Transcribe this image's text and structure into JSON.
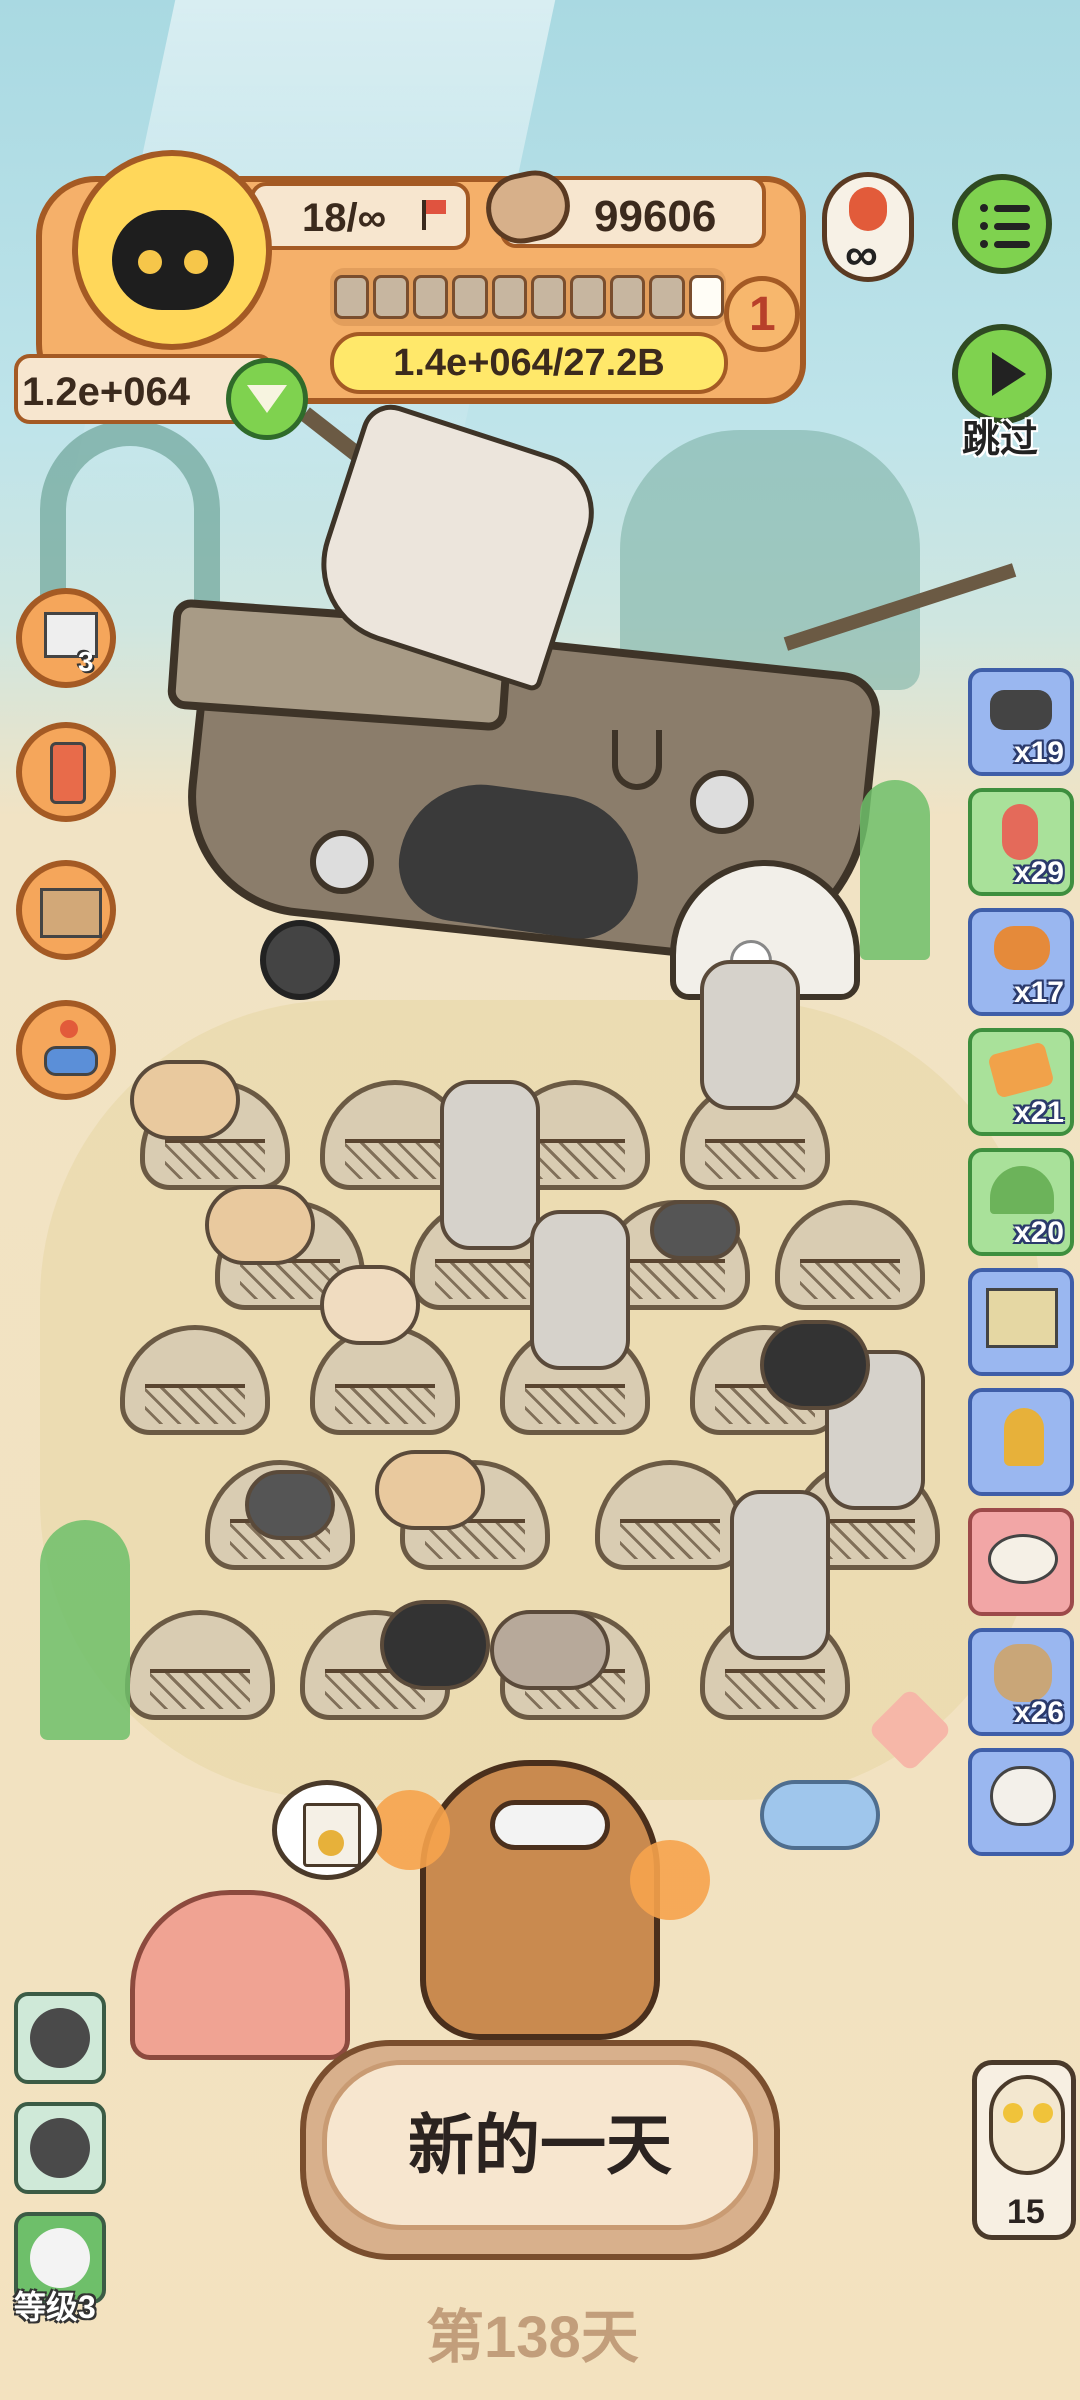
{
  "hud": {
    "capacity": "18/∞",
    "coins": "99606",
    "progress_label": "1.4e+064/27.2B",
    "level_number": "1",
    "resource_value": "1.2e+064",
    "progress_segments_filled": 9,
    "progress_segments_total": 10
  },
  "buttons": {
    "skip_label": "跳过",
    "menu_icon": "list-icon",
    "new_day_label": "新的一天",
    "infinity_symbol": "∞"
  },
  "left_tools": [
    {
      "name": "hourglass-book-icon",
      "badge": "3"
    },
    {
      "name": "phone-icon",
      "badge": ""
    },
    {
      "name": "box-icon",
      "badge": ""
    },
    {
      "name": "joystick-icon",
      "badge": ""
    }
  ],
  "right_inventory": [
    {
      "icon": "gadget-icon",
      "count": "x19",
      "style": "blue"
    },
    {
      "icon": "flamingo-icon",
      "count": "x29",
      "style": "green"
    },
    {
      "icon": "bread-icon",
      "count": "x17",
      "style": "blue"
    },
    {
      "icon": "ticket-icon",
      "count": "x21",
      "style": "green"
    },
    {
      "icon": "tent-icon",
      "count": "x20",
      "style": "green"
    },
    {
      "icon": "hut-icon",
      "count": "",
      "style": "blue"
    },
    {
      "icon": "trophy-icon",
      "count": "",
      "style": "blue"
    },
    {
      "icon": "fish-plate-icon",
      "count": "",
      "style": "red"
    },
    {
      "icon": "sack-icon",
      "count": "x26",
      "style": "blue"
    },
    {
      "icon": "sheep-icon",
      "count": "",
      "style": "blue"
    }
  ],
  "bottom": {
    "day_label": "第138天",
    "level_label": "等级3",
    "owl_count": "15"
  },
  "colors": {
    "hud_orange": "#f5b06a",
    "hud_border": "#a45a24",
    "button_green": "#7fd24f",
    "button_cream": "#f7e6cf"
  }
}
